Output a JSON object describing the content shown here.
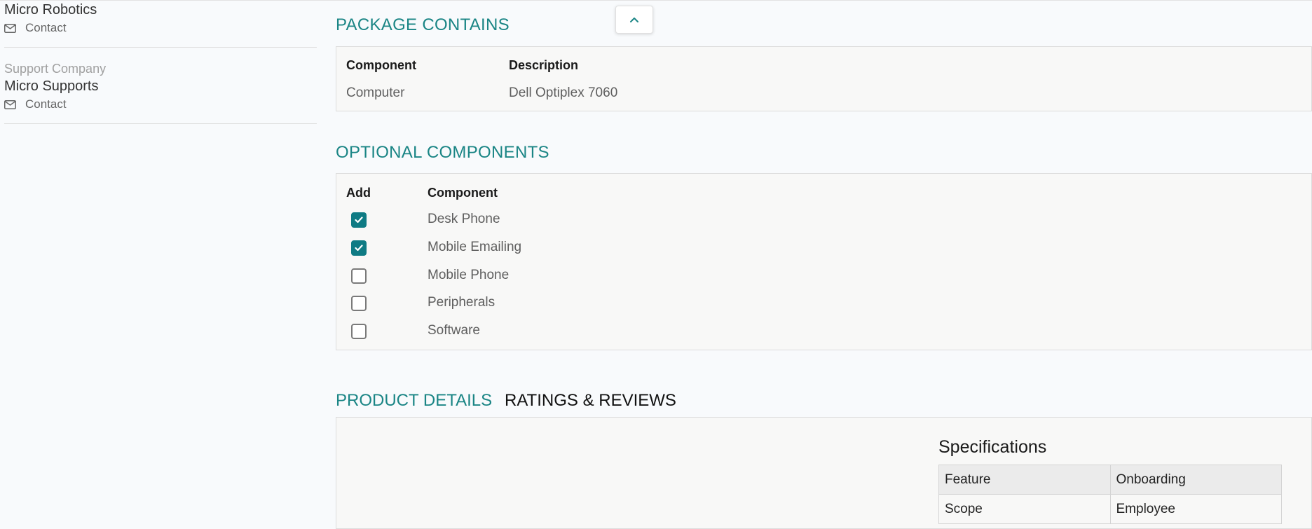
{
  "sidebar": {
    "vendor": {
      "name": "Micro Robotics",
      "contact_label": "Contact"
    },
    "support": {
      "label": "Support Company",
      "name": "Micro Supports",
      "contact_label": "Contact"
    }
  },
  "package_contains": {
    "title": "PACKAGE CONTAINS",
    "headers": [
      "Component",
      "Description"
    ],
    "rows": [
      {
        "component": "Computer",
        "description": "Dell Optiplex 7060"
      }
    ]
  },
  "optional_components": {
    "title": "OPTIONAL COMPONENTS",
    "headers": [
      "Add",
      "Component"
    ],
    "items": [
      {
        "label": "Desk Phone",
        "checked": true
      },
      {
        "label": "Mobile Emailing",
        "checked": true
      },
      {
        "label": "Mobile Phone",
        "checked": false
      },
      {
        "label": "Peripherals",
        "checked": false
      },
      {
        "label": "Software",
        "checked": false
      }
    ]
  },
  "tabs": [
    {
      "label": "PRODUCT DETAILS",
      "active": true
    },
    {
      "label": "RATINGS & REVIEWS",
      "active": false
    }
  ],
  "specifications": {
    "title": "Specifications",
    "header": [
      "Feature",
      "Onboarding"
    ],
    "rows": [
      [
        "Scope",
        "Employee"
      ]
    ]
  },
  "colors": {
    "accent": "#1a8585",
    "checkbox": "#0f7b84"
  },
  "icons": {
    "contact": "envelope-icon",
    "scroll_top": "chevron-up-icon",
    "check": "checkmark-icon"
  }
}
